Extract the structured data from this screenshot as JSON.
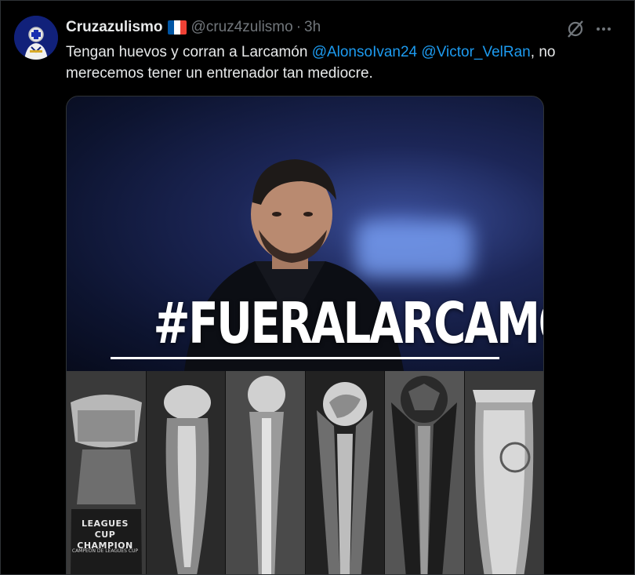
{
  "tweet": {
    "display_name": "Cruzazulismo",
    "handle": "@cruz4zulismo",
    "separator": "·",
    "time": "3h",
    "text_before": "Tengan huevos y corran a Larcamón ",
    "mention_1": "@AlonsoIvan24",
    "text_between": " ",
    "mention_2": "@Victor_VelRan",
    "text_after": ", no merecemos tener un entrenador tan mediocre."
  },
  "media": {
    "hashtag": "#FUERALARCAMON",
    "trophy_1_label_line1": "LEAGUES CUP",
    "trophy_1_label_line2": "CHAMPION",
    "trophy_1_sublabel": "CAMPEÓN DE LEAGUES CUP"
  },
  "icons": {
    "grok": "grok-icon",
    "more": "more-icon",
    "flag": "france-flag"
  },
  "colors": {
    "background": "#000000",
    "text": "#e7e9ea",
    "secondary": "#71767b",
    "mention": "#1d9bf0",
    "avatar": "#11217a"
  }
}
